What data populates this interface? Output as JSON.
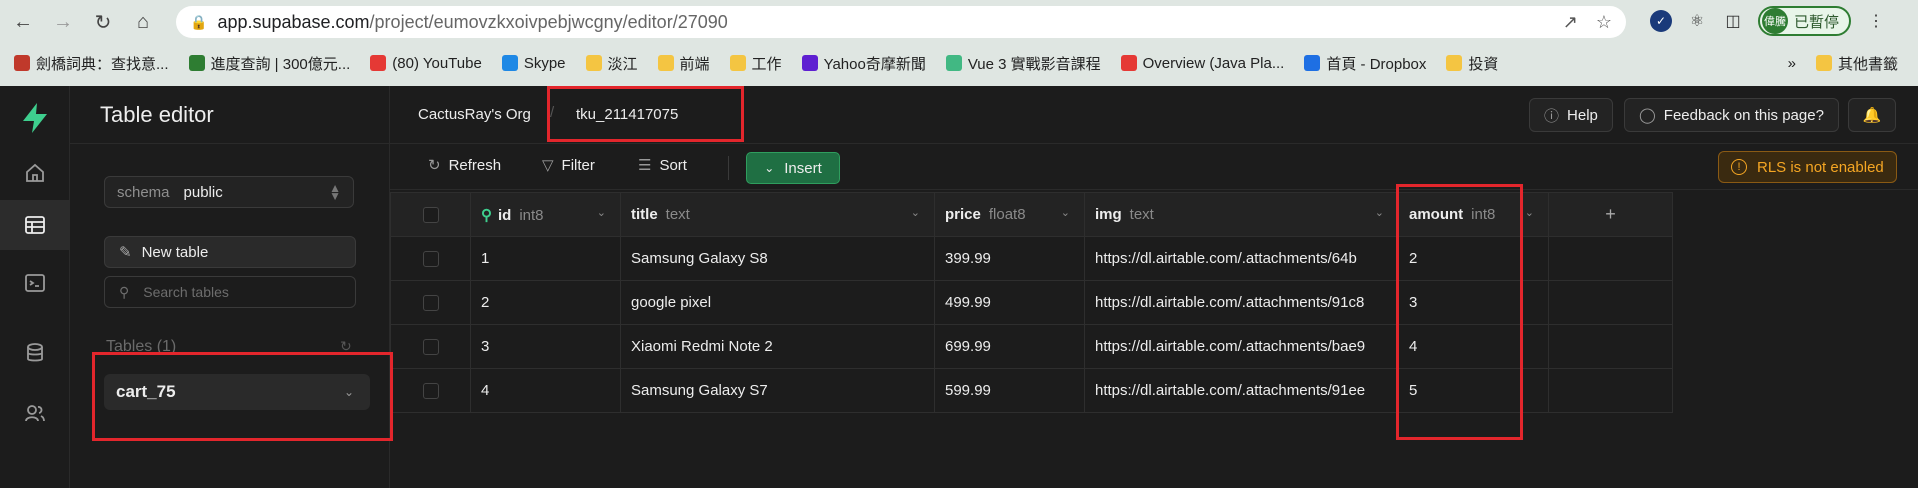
{
  "browser": {
    "url_host": "app.supabase.com",
    "url_path": "/project/eumovzkxoivpebjwcgny/editor/27090",
    "profile_initials": "偉騰",
    "profile_status": "已暫停",
    "bookmarks": [
      {
        "label": "劍橋詞典：查找意...",
        "color": "#c0392b"
      },
      {
        "label": "進度查詢 | 300億元...",
        "color": "#2e7d32"
      },
      {
        "label": "(80) YouTube",
        "color": "#e53935"
      },
      {
        "label": "Skype",
        "color": "#1e88e5"
      },
      {
        "label": "淡江",
        "color": "#f4c542"
      },
      {
        "label": "前端",
        "color": "#f4c542"
      },
      {
        "label": "工作",
        "color": "#f4c542"
      },
      {
        "label": "Yahoo奇摩新聞",
        "color": "#5e1fd1"
      },
      {
        "label": "Vue 3 實戰影音課程",
        "color": "#41b883"
      },
      {
        "label": "Overview (Java Pla...",
        "color": "#e53935"
      },
      {
        "label": "首頁 - Dropbox",
        "color": "#1e6fe3"
      },
      {
        "label": "投資",
        "color": "#f4c542"
      }
    ],
    "bookmarks_more": "»",
    "other_bookmarks": "其他書籤"
  },
  "sidebar": {
    "title": "Table editor",
    "schema_label": "schema",
    "schema_value": "public",
    "new_table": "New table",
    "search_placeholder": "Search tables",
    "tables_count": "Tables (1)",
    "table_name": "cart_75"
  },
  "topbar": {
    "org": "CactusRay's Org",
    "separator": "/",
    "project": "tku_211417075",
    "help": "Help",
    "feedback": "Feedback on this page?"
  },
  "toolbar": {
    "refresh": "Refresh",
    "filter": "Filter",
    "sort": "Sort",
    "insert": "Insert",
    "rls_warning": "RLS is not enabled"
  },
  "grid": {
    "columns": [
      {
        "name": "id",
        "type": "int8"
      },
      {
        "name": "title",
        "type": "text"
      },
      {
        "name": "price",
        "type": "float8"
      },
      {
        "name": "img",
        "type": "text"
      },
      {
        "name": "amount",
        "type": "int8"
      }
    ],
    "add_column": "+",
    "rows": [
      {
        "id": "1",
        "title": "Samsung Galaxy S8",
        "price": "399.99",
        "img": "https://dl.airtable.com/.attachments/64b",
        "amount": "2"
      },
      {
        "id": "2",
        "title": "google pixel",
        "price": "499.99",
        "img": "https://dl.airtable.com/.attachments/91c8",
        "amount": "3"
      },
      {
        "id": "3",
        "title": "Xiaomi Redmi Note 2",
        "price": "699.99",
        "img": "https://dl.airtable.com/.attachments/bae9",
        "amount": "4"
      },
      {
        "id": "4",
        "title": "Samsung Galaxy S7",
        "price": "599.99",
        "img": "https://dl.airtable.com/.attachments/91ee",
        "amount": "5"
      }
    ]
  },
  "colors": {
    "brand_green": "#3ecf8e",
    "annotation_red": "#e3262c",
    "warning_orange": "#f5a623"
  }
}
